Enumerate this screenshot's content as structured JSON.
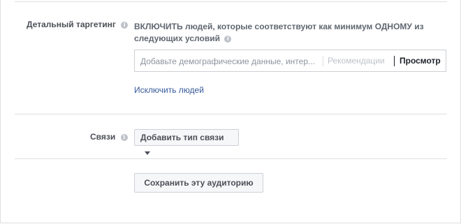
{
  "targeting": {
    "label": "Детальный таргетинг",
    "include_text": "ВКЛЮЧИТЬ людей, которые соответствуют как минимум ОДНОМУ из следующих условий",
    "search_placeholder": "Добавьте демографические данные, интер...",
    "recommendations_label": "Рекомендации",
    "browse_label": "Просмотр",
    "exclude_link": "Исключить людей"
  },
  "connections": {
    "label": "Связи",
    "add_button": "Добавить тип связи"
  },
  "actions": {
    "save_button": "Сохранить эту аудиторию"
  },
  "icons": {
    "info": "info-icon",
    "dropdown": "chevron-down-icon"
  }
}
